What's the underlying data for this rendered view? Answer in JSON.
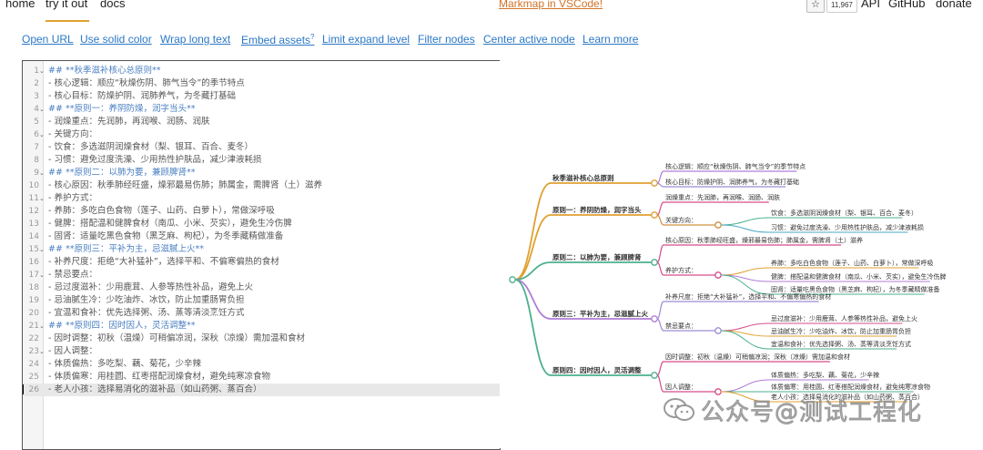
{
  "nav": {
    "home": "home",
    "try_it_out": "try it out",
    "docs": "docs",
    "markmap_vscode": "Markmap in VSCode!",
    "star_count": "11,967",
    "api": "API",
    "github": "GitHub",
    "donate": "donate"
  },
  "toolbar": {
    "open_url": "Open URL",
    "use_solid_color": "Use solid color",
    "wrap_long_text": "Wrap long text",
    "embed_assets": "Embed assets",
    "embed_assets_sup": "?",
    "limit_expand_level": "Limit expand level",
    "filter_nodes": "Filter nodes",
    "center_active_node": "Center active node",
    "learn_more": "Learn more"
  },
  "editor": {
    "lines": [
      {
        "n": "1",
        "fold": true,
        "heading": true,
        "text": "## **秋季滋补核心总原则**"
      },
      {
        "n": "2",
        "fold": false,
        "heading": false,
        "text": "- 核心逻辑：顺应“秋燥伤阴、肺气当令”的季节特点"
      },
      {
        "n": "3",
        "fold": false,
        "heading": false,
        "text": "- 核心目标：防燥护阴、润肺养气，为冬藏打基础"
      },
      {
        "n": "4",
        "fold": true,
        "heading": true,
        "text": "## **原则一：养阴防燥，润字当头**"
      },
      {
        "n": "5",
        "fold": false,
        "heading": false,
        "text": "- 润燥重点：先润肺，再润喉、润肠、润肤"
      },
      {
        "n": "6",
        "fold": true,
        "heading": false,
        "text": "- 关键方向："
      },
      {
        "n": "7",
        "fold": false,
        "heading": false,
        "text": "  - 饮食：多选滋阴润燥食材（梨、银耳、百合、麦冬）"
      },
      {
        "n": "8",
        "fold": false,
        "heading": false,
        "text": "  - 习惯：避免过度洗澡、少用热性护肤品，减少津液耗损"
      },
      {
        "n": "9",
        "fold": true,
        "heading": true,
        "text": "## **原则二：以肺为要，兼顾脾肾**"
      },
      {
        "n": "10",
        "fold": false,
        "heading": false,
        "text": "- 核心原因：秋季肺经旺盛，燥邪最易伤肺；肺属金，需脾肾（土）滋养"
      },
      {
        "n": "11",
        "fold": true,
        "heading": false,
        "text": "- 养护方式："
      },
      {
        "n": "12",
        "fold": false,
        "heading": false,
        "text": "  - 养肺：多吃白色食物（莲子、山药、白萝卜），常做深呼吸"
      },
      {
        "n": "13",
        "fold": false,
        "heading": false,
        "text": "  - 健脾：搭配温和健脾食材（南瓜、小米、芡实），避免生冷伤脾"
      },
      {
        "n": "14",
        "fold": false,
        "heading": false,
        "text": "  - 固肾：适量吃黑色食物（黑芝麻、枸杞），为冬季藏精做准备"
      },
      {
        "n": "15",
        "fold": true,
        "heading": true,
        "text": "## **原则三：平补为主，忌滋腻上火**"
      },
      {
        "n": "16",
        "fold": false,
        "heading": false,
        "text": "- 补养尺度：拒绝“大补猛补”，选择平和、不偏寒偏热的食材"
      },
      {
        "n": "17",
        "fold": true,
        "heading": false,
        "text": "- 禁忌要点："
      },
      {
        "n": "18",
        "fold": false,
        "heading": false,
        "text": "  - 忌过度滋补：少用鹿茸、人参等热性补品，避免上火"
      },
      {
        "n": "19",
        "fold": false,
        "heading": false,
        "text": "  - 忌油腻生冷：少吃油炸、冰饮，防止加重肠胃负担"
      },
      {
        "n": "20",
        "fold": false,
        "heading": false,
        "text": "  - 宜温和食补：优先选择粥、汤、蒸等清淡烹饪方式"
      },
      {
        "n": "21",
        "fold": true,
        "heading": true,
        "text": "## **原则四：因时因人，灵活调整**"
      },
      {
        "n": "22",
        "fold": false,
        "heading": false,
        "text": "- 因时调整：初秋（温燥）可稍偏凉润，深秋（凉燥）需加温和食材"
      },
      {
        "n": "23",
        "fold": true,
        "heading": false,
        "text": "- 因人调整："
      },
      {
        "n": "24",
        "fold": false,
        "heading": false,
        "text": "  - 体质偏热：多吃梨、藕、菊花，少辛辣"
      },
      {
        "n": "25",
        "fold": false,
        "heading": false,
        "text": "  - 体质偏寒：用桂圆、红枣搭配润燥食材，避免纯寒凉食物"
      },
      {
        "n": "26",
        "fold": false,
        "heading": false,
        "text": "  - 老人小孩：选择易消化的滋补品（如山药粥、蒸百合）"
      }
    ]
  },
  "mindmap": {
    "branches": [
      {
        "label": "秋季滋补核心总原则",
        "color": "#e0a030",
        "children": [
          {
            "label": "核心逻辑：顺应“秋燥伤阴、肺气当令”的季节特点",
            "color": "#b07dd6"
          },
          {
            "label": "核心目标：防燥护阴、润肺养气，为冬藏打基础",
            "color": "#9d8cd6"
          }
        ]
      },
      {
        "label": "原则一：养阴防燥，润字当头",
        "color": "#e0a030",
        "children": [
          {
            "label": "润燥重点：先润肺，再润喉、润肠、润肤",
            "color": "#d64c8c"
          },
          {
            "label": "关键方向：",
            "color": "#d09040",
            "children": [
              {
                "label": "饮食：多选滋阴润燥食材（梨、银耳、百合、麦冬）",
                "color": "#4bb08c"
              },
              {
                "label": "习惯：避免过度洗澡、少用热性护肤品，减少津液耗损",
                "color": "#48a7c4"
              }
            ]
          }
        ]
      },
      {
        "label": "原则二：以肺为要，兼顾脾肾",
        "color": "#4bb08c",
        "children": [
          {
            "label": "核心原因：秋季肺经旺盛，燥邪最易伤肺；肺属金，需脾肾（土）滋养",
            "color": "#d64c8c"
          },
          {
            "label": "养护方式：",
            "color": "#d64c8c",
            "children": [
              {
                "label": "养肺：多吃白色食物（莲子、山药、白萝卜），常做深呼吸",
                "color": "#e0a030"
              },
              {
                "label": "健脾：搭配温和健脾食材（南瓜、小米、芡实），避免生冷伤脾",
                "color": "#b07dd6"
              },
              {
                "label": "固肾：适量吃黑色食物（黑芝麻、枸杞），为冬季藏精做准备",
                "color": "#4bb08c"
              }
            ]
          }
        ]
      },
      {
        "label": "原则三：平补为主，忌滋腻上火",
        "color": "#b07dd6",
        "children": [
          {
            "label": "补养尺度：拒绝“大补猛补”，选择平和、不偏寒偏热的食材",
            "color": "#9d8cd6"
          },
          {
            "label": "禁忌要点：",
            "color": "#9d8cd6",
            "children": [
              {
                "label": "忌过度滋补：少用鹿茸、人参等热性补品，避免上火",
                "color": "#d64c8c"
              },
              {
                "label": "忌油腻生冷：少吃油炸、冰饮，防止加重肠胃负担",
                "color": "#e0a030"
              },
              {
                "label": "宜温和食补：优先选择粥、汤、蒸等清淡烹饪方式",
                "color": "#4bb08c"
              }
            ]
          }
        ]
      },
      {
        "label": "原则四：因时因人，灵活调整",
        "color": "#4bb08c",
        "children": [
          {
            "label": "因时调整：初秋（温燥）可稍偏凉润；深秋（凉燥）需加温和食材",
            "color": "#d64c8c"
          },
          {
            "label": "因人调整：",
            "color": "#d64c8c",
            "children": [
              {
                "label": "体质偏热：多吃梨、藕、菊花，少辛辣",
                "color": "#b07dd6"
              },
              {
                "label": "体质偏寒：用桂圆、红枣搭配润燥食材，避免纯寒凉食物",
                "color": "#4bb08c"
              },
              {
                "label": "老人小孩：选择易消化的滋补品（如山药粥、蒸百合）",
                "color": "#e0a030"
              }
            ]
          }
        ]
      }
    ]
  },
  "watermark": {
    "text": "公众号@测试工程化"
  }
}
